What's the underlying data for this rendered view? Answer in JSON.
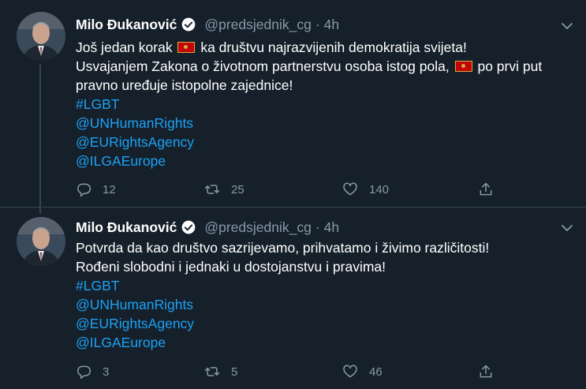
{
  "tweets": [
    {
      "author_name": "Milo Đukanović",
      "handle": "@predsjednik_cg",
      "separator": "·",
      "time": "4h",
      "line1_a": "Još jedan korak",
      "line1_b": "ka društvu najrazvijenih demokratija svijeta!",
      "line2_a": "Usvajanjem Zakona o životnom partnerstvu osoba istog pola,",
      "line2_b": "po prvi put",
      "line3": "pravno uređuje istopolne zajednice!",
      "tags": [
        "#LGBT",
        "@UNHumanRights",
        "@EURightsAgency",
        "@ILGAEurope"
      ],
      "replies": "12",
      "retweets": "25",
      "likes": "140"
    },
    {
      "author_name": "Milo Đukanović",
      "handle": "@predsjednik_cg",
      "separator": "·",
      "time": "4h",
      "line1": "Potvrda da kao društvo sazrijevamo, prihvatamo i živimo različitosti!",
      "line2": "Rođeni slobodni i jednaki u dostojanstvu i pravima!",
      "tags": [
        "#LGBT",
        "@UNHumanRights",
        "@EURightsAgency",
        "@ILGAEurope"
      ],
      "replies": "3",
      "retweets": "5",
      "likes": "46"
    }
  ],
  "colors": {
    "background": "#15202b",
    "text": "#ffffff",
    "secondary": "#8899a6",
    "link": "#1da1f2",
    "divider": "#38444d",
    "flag_red": "#c40308",
    "flag_gold": "#d3ae3b"
  },
  "icons": {
    "verified": "verified-badge-icon",
    "caret": "chevron-down-icon",
    "reply": "reply-icon",
    "retweet": "retweet-icon",
    "like": "heart-icon",
    "share": "share-icon",
    "flag": "montenegro-flag-icon"
  }
}
